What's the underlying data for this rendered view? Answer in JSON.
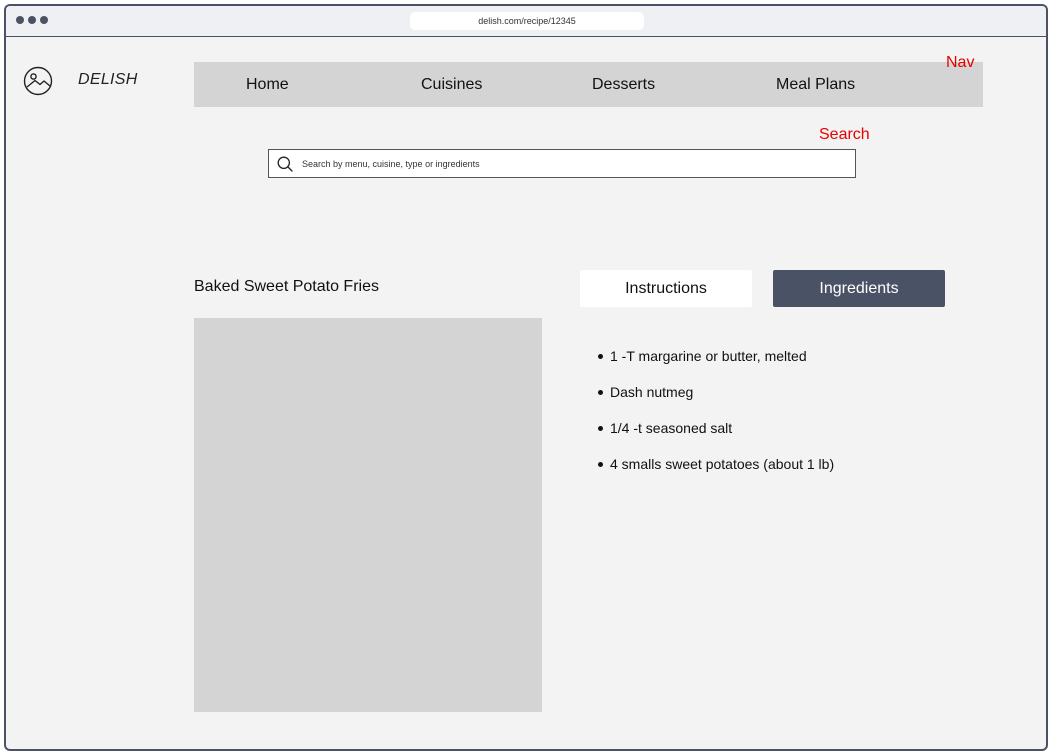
{
  "browser": {
    "url": "delish.com/recipe/12345"
  },
  "header": {
    "brand": "DELISH",
    "logo_icon": "image-placeholder-icon"
  },
  "nav": {
    "items": [
      {
        "label": "Home"
      },
      {
        "label": "Cuisines"
      },
      {
        "label": "Desserts"
      },
      {
        "label": "Meal Plans"
      }
    ],
    "annotation": "Nav"
  },
  "search": {
    "annotation": "Search",
    "placeholder": "Search by menu, cuisine, type or ingredients",
    "icon": "search-icon"
  },
  "recipe": {
    "title": "Baked Sweet Potato Fries"
  },
  "tabs": [
    {
      "label": "Instructions",
      "active": false
    },
    {
      "label": "Ingredients",
      "active": true
    }
  ],
  "ingredients": [
    "1 -T margarine or butter, melted",
    "Dash nutmeg",
    "1/4 -t seasoned salt",
    "4 smalls sweet potatoes (about 1 lb)"
  ],
  "colors": {
    "accent_tab": "#4a5366",
    "annotation": "#e60000",
    "placeholder_gray": "#d4d4d4"
  }
}
